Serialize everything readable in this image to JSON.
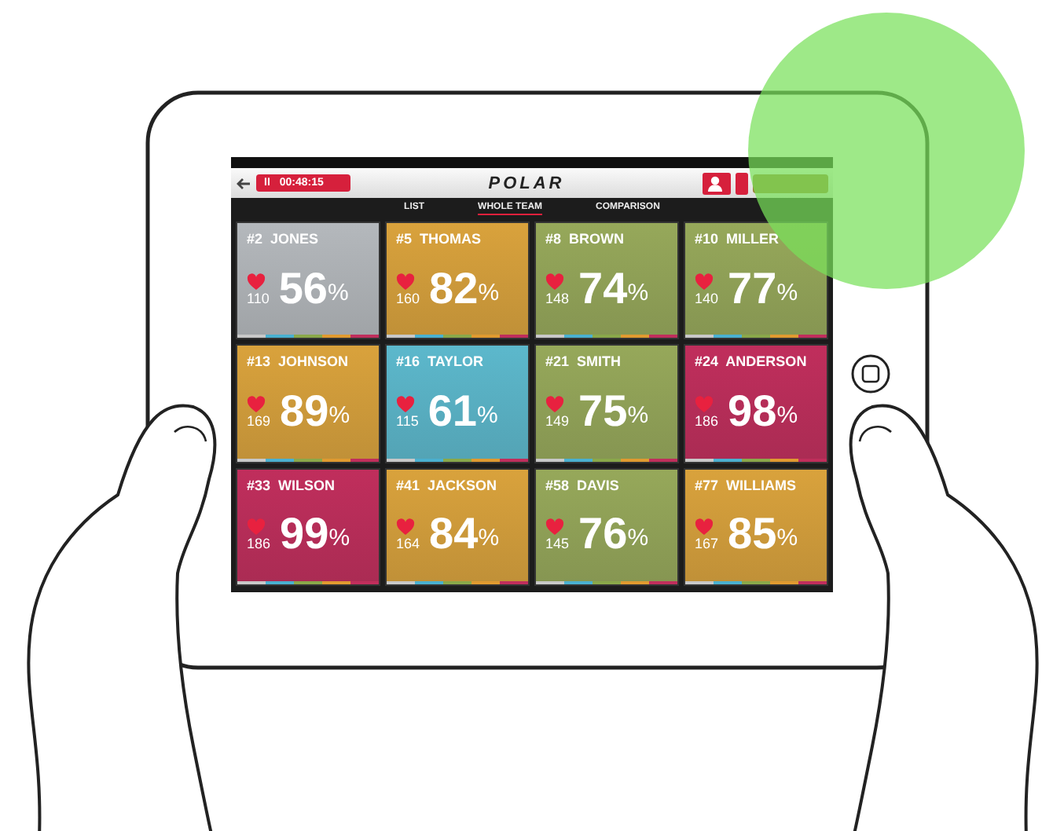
{
  "header": {
    "timer": {
      "state_icon": "II",
      "time": "00:48:15"
    },
    "logo": "POLAR"
  },
  "nav_tabs": [
    {
      "label": "LIST",
      "selected": false
    },
    {
      "label": "WHOLE TEAM",
      "selected": true
    },
    {
      "label": "COMPARISON",
      "selected": false
    }
  ],
  "players": [
    {
      "name": "#2  JONES",
      "heart_rate": "110",
      "value": "56",
      "unit": "%",
      "color": "#b4b8bc"
    },
    {
      "name": "#5  THOMAS",
      "heart_rate": "160",
      "value": "82",
      "unit": "%",
      "color": "#d9a23c"
    },
    {
      "name": "#8  BROWN",
      "heart_rate": "148",
      "value": "74",
      "unit": "%",
      "color": "#96a85a"
    },
    {
      "name": "#10  MILLER",
      "heart_rate": "140",
      "value": "77",
      "unit": "%",
      "color": "#96a85a"
    },
    {
      "name": "#13  JOHNSON",
      "heart_rate": "169",
      "value": "89",
      "unit": "%",
      "color": "#d9a23c"
    },
    {
      "name": "#16  TAYLOR",
      "heart_rate": "115",
      "value": "61",
      "unit": "%",
      "color": "#5cb8cc"
    },
    {
      "name": "#21  SMITH",
      "heart_rate": "149",
      "value": "75",
      "unit": "%",
      "color": "#96a85a"
    },
    {
      "name": "#24  ANDERSON",
      "heart_rate": "186",
      "value": "98",
      "unit": "%",
      "color": "#c02e5c"
    },
    {
      "name": "#33  WILSON",
      "heart_rate": "186",
      "value": "99",
      "unit": "%",
      "color": "#c02e5c"
    },
    {
      "name": "#41  JACKSON",
      "heart_rate": "164",
      "value": "84",
      "unit": "%",
      "color": "#d9a23c"
    },
    {
      "name": "#58  DAVIS",
      "heart_rate": "145",
      "value": "76",
      "unit": "%",
      "color": "#96a85a"
    },
    {
      "name": "#77  WILLIAMS",
      "heart_rate": "167",
      "value": "85",
      "unit": "%",
      "color": "#d9a23c"
    }
  ]
}
